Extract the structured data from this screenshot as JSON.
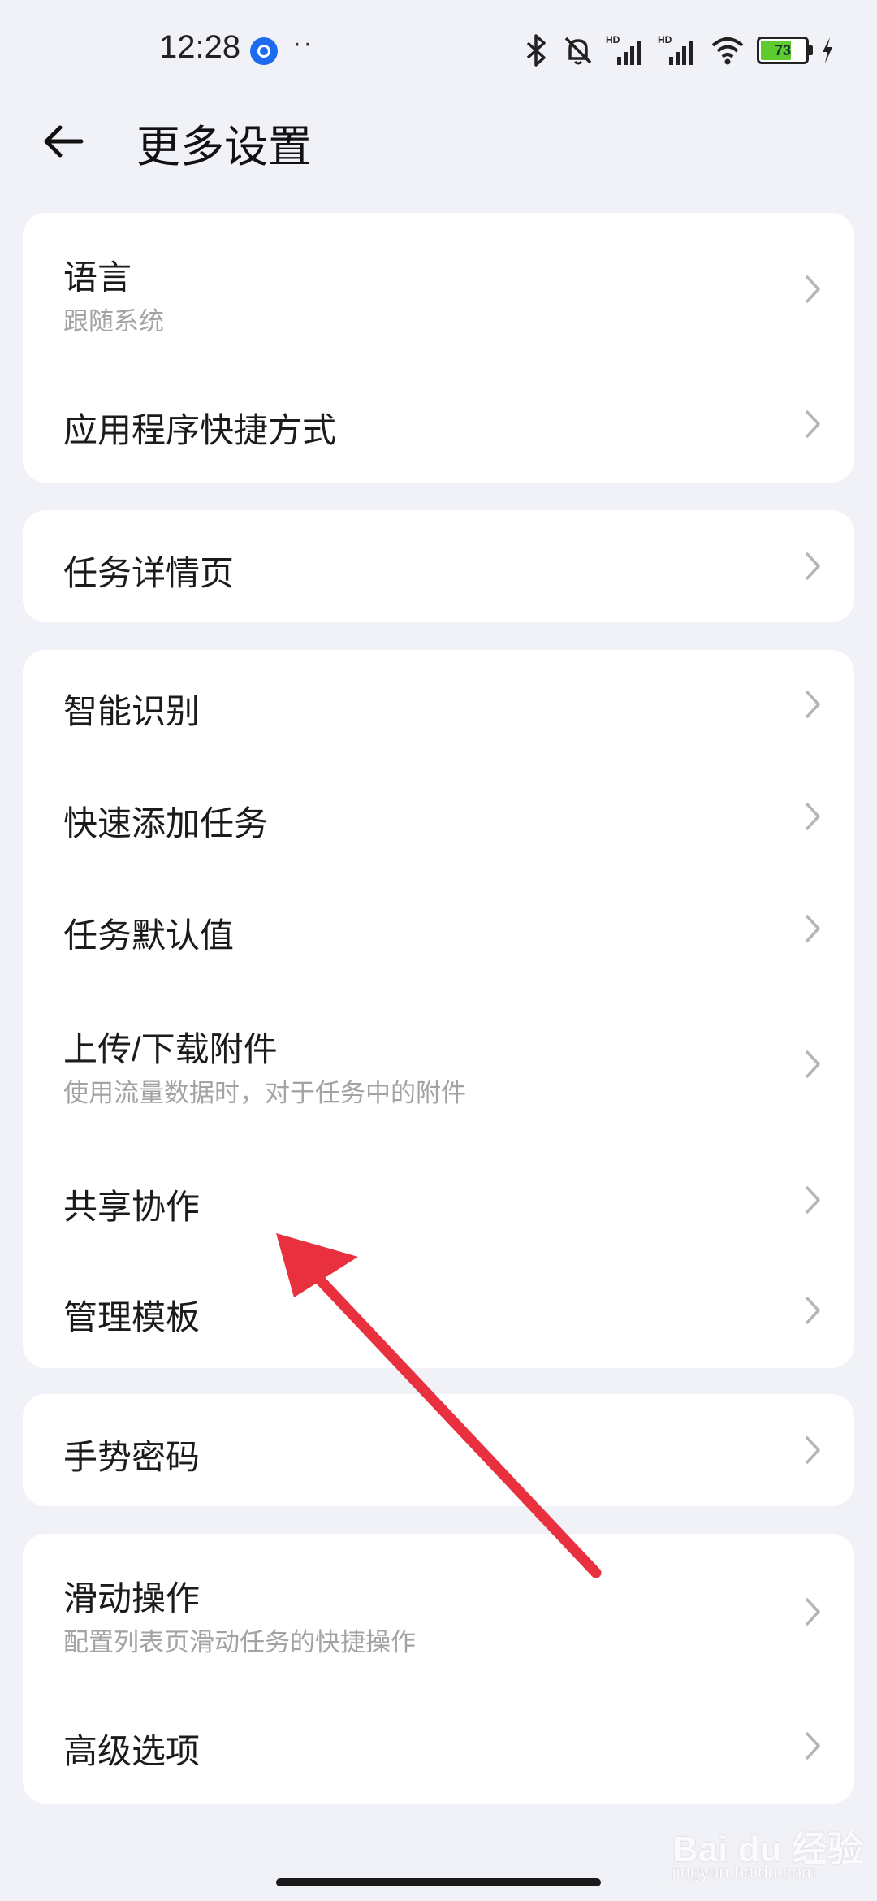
{
  "status_bar": {
    "time": "12:28",
    "dots": "··",
    "battery": "73",
    "battery_level": 0.73,
    "icons": [
      "bluetooth-icon",
      "mute-bell-icon",
      "hd-signal-icon",
      "hd-signal-icon",
      "wifi-icon",
      "battery-icon",
      "charging-icon"
    ]
  },
  "header": {
    "title": "更多设置",
    "back_icon": "back-arrow-icon"
  },
  "cards": [
    {
      "items": [
        {
          "title": "语言",
          "subtitle": "跟随系统"
        },
        {
          "title": "应用程序快捷方式"
        }
      ]
    },
    {
      "items": [
        {
          "title": "任务详情页"
        }
      ]
    },
    {
      "items": [
        {
          "title": "智能识别"
        },
        {
          "title": "快速添加任务"
        },
        {
          "title": "任务默认值"
        },
        {
          "title": "上传/下载附件",
          "subtitle": "使用流量数据时，对于任务中的附件"
        },
        {
          "title": "共享协作"
        },
        {
          "title": "管理模板"
        }
      ]
    },
    {
      "items": [
        {
          "title": "手势密码"
        }
      ]
    },
    {
      "items": [
        {
          "title": "滑动操作",
          "subtitle": "配置列表页滑动任务的快捷操作"
        },
        {
          "title": "高级选项"
        }
      ]
    }
  ],
  "colors": {
    "background": "#f1f2f7",
    "card": "#ffffff",
    "annotation_arrow": "#e8303f",
    "battery_fill": "#5ecb2e"
  },
  "watermark": {
    "text": "Bai du 经验",
    "sub": "jingyan.baidu.com"
  }
}
